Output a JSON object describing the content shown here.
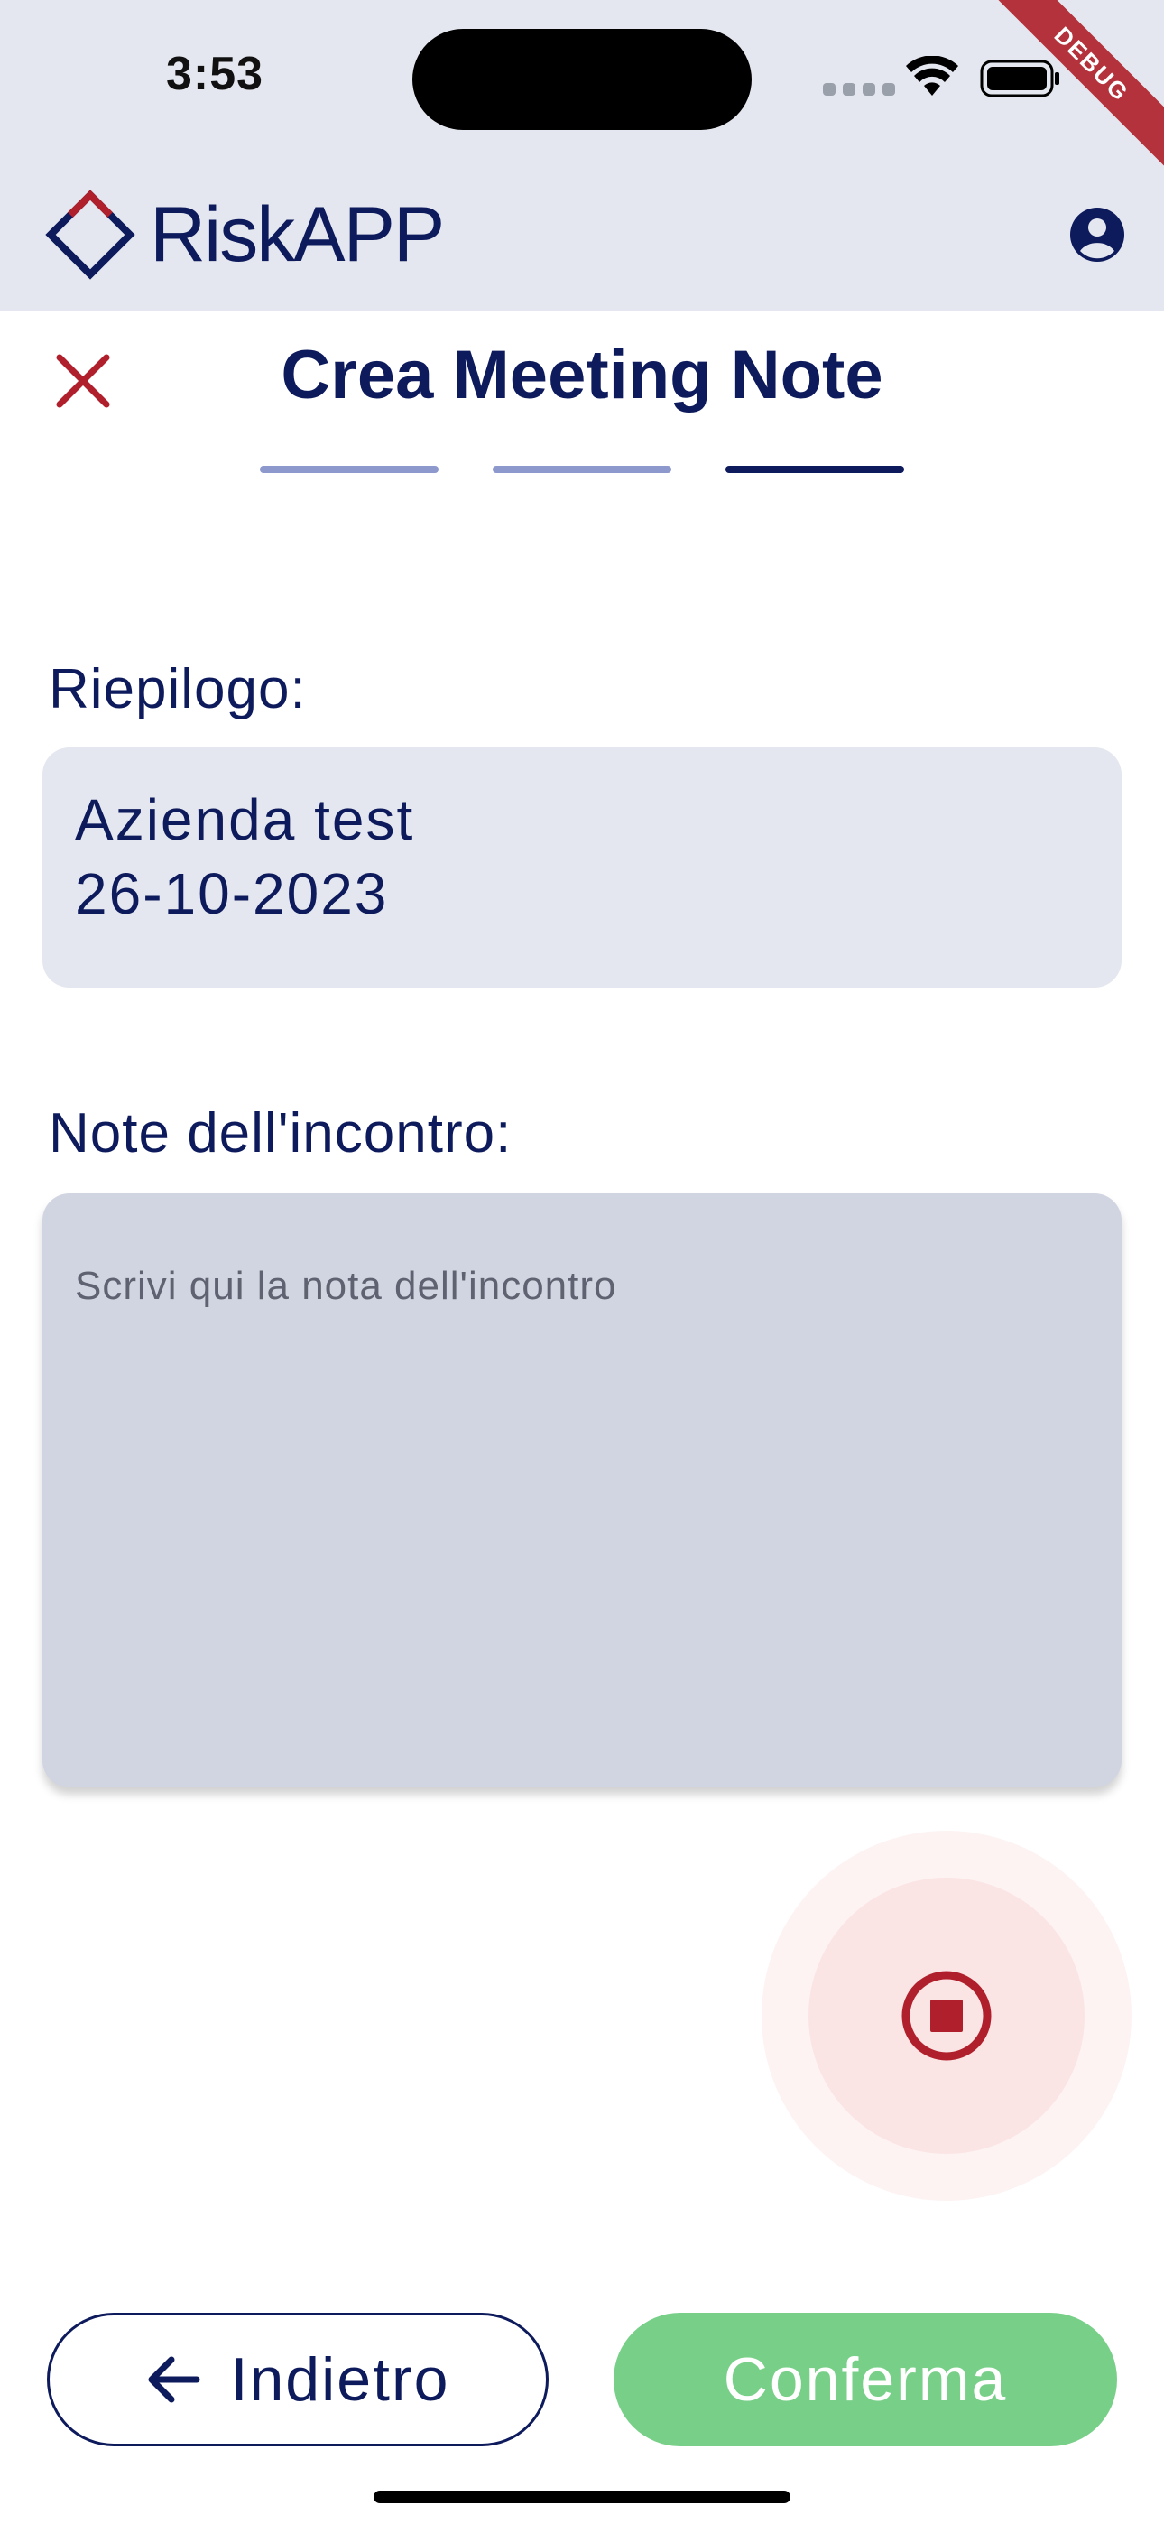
{
  "status_bar": {
    "time": "3:53",
    "debug_banner": "DEBUG"
  },
  "app_bar": {
    "logo_text": "RiskAPP",
    "account_icon": "account-circle-icon"
  },
  "header": {
    "title": "Crea Meeting Note",
    "close_icon": "close-icon",
    "steps_total": 3,
    "current_step": 3
  },
  "summary": {
    "label": "Riepilogo:",
    "company": "Azienda test",
    "date": "26-10-2023"
  },
  "notes": {
    "label": "Note dell'incontro:",
    "placeholder": "Scrivi qui la nota dell'incontro",
    "value": ""
  },
  "recorder": {
    "state": "recording",
    "icon": "stop-circle-icon"
  },
  "actions": {
    "back_label": "Indietro",
    "confirm_label": "Conferma"
  },
  "colors": {
    "primary": "#0d1a5c",
    "accent_red": "#b0202c",
    "confirm_green": "#77cf88",
    "surface": "#e4e7ef",
    "field": "#d1d5e1"
  }
}
